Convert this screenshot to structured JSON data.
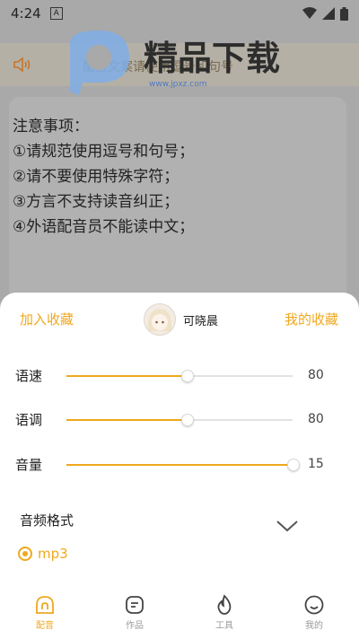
{
  "status_bar": {
    "time": "4:24",
    "notif_badge": "A"
  },
  "background": {
    "banner_text": "配音文案请使用逗号和句号",
    "watermark_title": "精品下载",
    "watermark_url": "www.jpxz.com",
    "notice_lines": [
      "注意事项：",
      "①请规范使用逗号和句号；",
      "②请不要使用特殊字符；",
      "③方言不支持读音纠正；",
      "④外语配音员不能读中文；"
    ]
  },
  "sheet": {
    "add_favorite": "加入收藏",
    "my_favorites": "我的收藏",
    "voice_name": "可晓晨",
    "sliders": [
      {
        "label": "语速",
        "value": "80",
        "fraction": 0.53
      },
      {
        "label": "语调",
        "value": "80",
        "fraction": 0.53
      },
      {
        "label": "音量",
        "value": "15",
        "fraction": 1.0
      }
    ],
    "format_title": "音频格式",
    "format_selected": "mp3"
  },
  "nav": [
    {
      "label": "配音",
      "icon": "dubbing-icon",
      "active": true
    },
    {
      "label": "作品",
      "icon": "works-icon",
      "active": false
    },
    {
      "label": "工具",
      "icon": "tools-icon",
      "active": false
    },
    {
      "label": "我的",
      "icon": "profile-icon",
      "active": false
    }
  ],
  "colors": {
    "accent": "#f0a81e",
    "overlay": "#a9a9a9"
  }
}
